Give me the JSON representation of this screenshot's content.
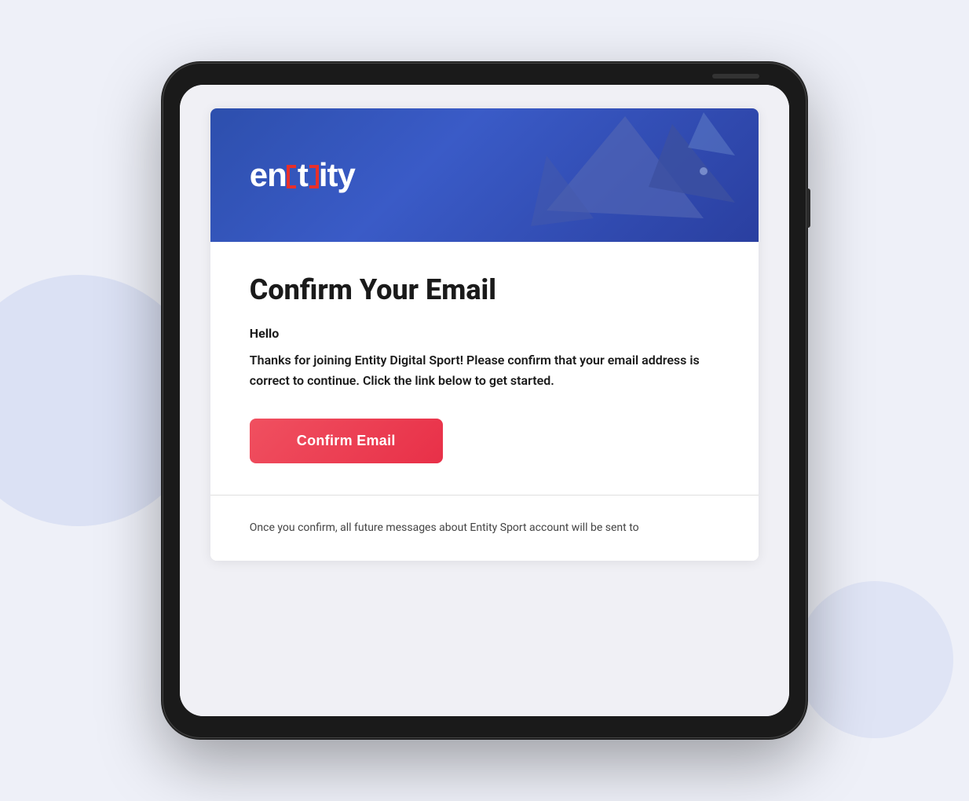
{
  "page": {
    "background_color": "#eef0f8"
  },
  "header": {
    "logo_text": "entity",
    "background_from": "#2d4fad",
    "background_to": "#2a3fa0"
  },
  "email": {
    "title": "Confirm Your Email",
    "greeting": "Hello",
    "body_text": "Thanks for joining Entity Digital Sport! Please confirm that your email address is correct to continue. Click the link below to get started.",
    "confirm_button_label": "Confirm Email",
    "confirm_button_color": "#f05060",
    "footer_text": "Once you confirm, all future messages about Entity Sport account will be sent to"
  }
}
